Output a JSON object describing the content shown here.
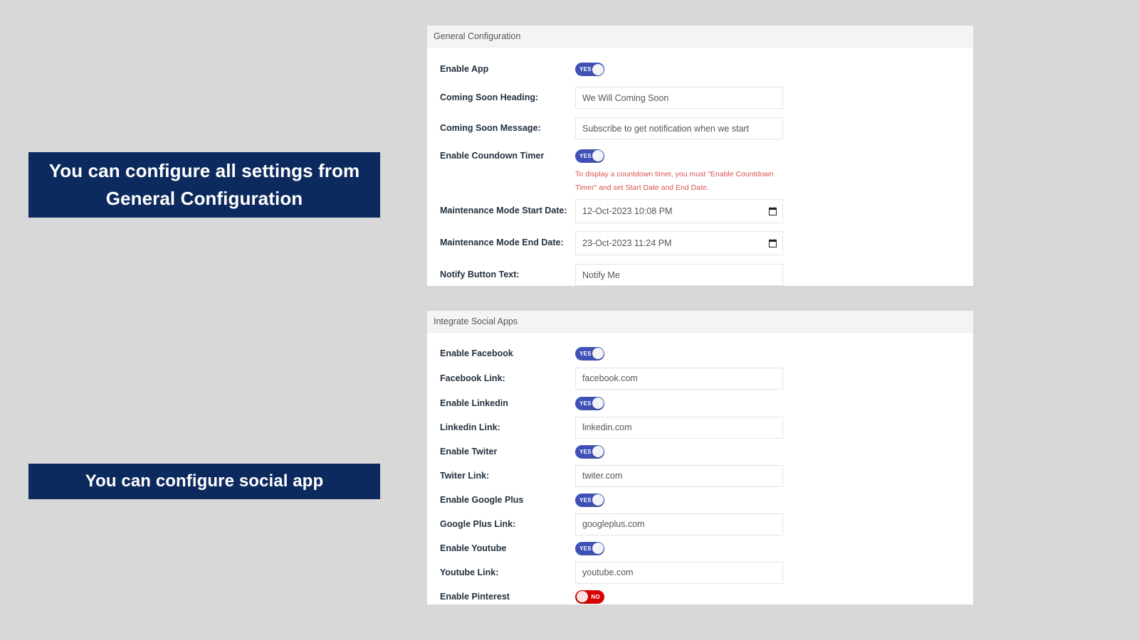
{
  "callouts": {
    "general": "You can configure all settings from General Configuration",
    "social": "You can configure social app"
  },
  "general_panel": {
    "title": "General Configuration",
    "toggle_labels": {
      "on": "YES",
      "off": "NO"
    },
    "rows": [
      {
        "type": "toggle",
        "label": "Enable App",
        "state": "YES"
      },
      {
        "type": "input",
        "label": "Coming Soon Heading:",
        "value": "We Will Coming Soon"
      },
      {
        "type": "input",
        "label": "Coming Soon Message:",
        "value": "Subscribe to get notification when we start"
      },
      {
        "type": "toggle",
        "label": "Enable Coundown Timer",
        "state": "YES"
      },
      {
        "type": "date",
        "label": "Maintenance Mode Start Date:",
        "value": "12-Oct-2023 10:08 PM"
      },
      {
        "type": "date",
        "label": "Maintenance Mode End Date:",
        "value": "23-Oct-2023 11:24 PM"
      },
      {
        "type": "input",
        "label": "Notify Button Text:",
        "value": "Notify Me"
      }
    ],
    "helper_text": "To display a countdown timer, you must \"Enable Countdown Timer\" and set Start Date and End Date.",
    "helper_color": "#d9534f"
  },
  "social_panel": {
    "title": "Integrate Social Apps",
    "rows": [
      {
        "type": "toggle",
        "label": "Enable Facebook",
        "state": "YES"
      },
      {
        "type": "input",
        "label": "Facebook Link:",
        "value": "facebook.com"
      },
      {
        "type": "toggle",
        "label": "Enable Linkedin",
        "state": "YES"
      },
      {
        "type": "input",
        "label": "Linkedin Link:",
        "value": "linkedin.com"
      },
      {
        "type": "toggle",
        "label": "Enable Twiter",
        "state": "YES"
      },
      {
        "type": "input",
        "label": "Twiter Link:",
        "value": "twiter.com"
      },
      {
        "type": "toggle",
        "label": "Enable Google Plus",
        "state": "YES"
      },
      {
        "type": "input",
        "label": "Google Plus Link:",
        "value": "googleplus.com"
      },
      {
        "type": "toggle",
        "label": "Enable Youtube",
        "state": "YES"
      },
      {
        "type": "input",
        "label": "Youtube Link:",
        "value": "youtube.com"
      },
      {
        "type": "toggle",
        "label": "Enable Pinterest",
        "state": "NO"
      }
    ]
  },
  "colors": {
    "page_background": "#d8d8d8",
    "panel_background": "#ffffff",
    "panel_header": "#f4f4f4",
    "callout_background": "#0d2a5e",
    "toggle_on": "#3f51b5",
    "toggle_off": "#d50000",
    "label_text": "#22303f"
  }
}
